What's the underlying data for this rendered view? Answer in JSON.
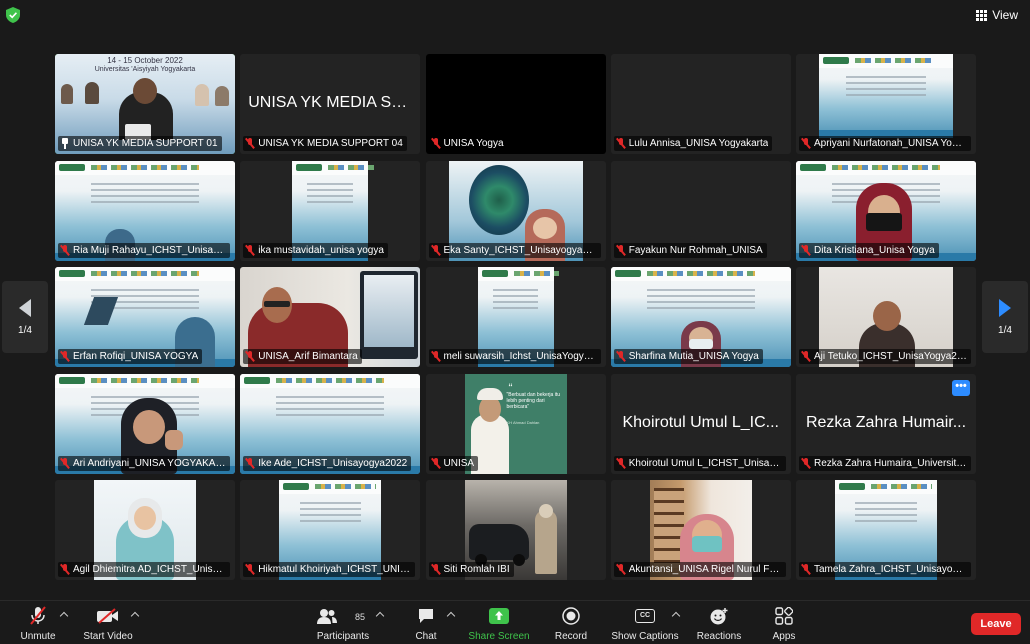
{
  "topbar": {
    "view_label": "View"
  },
  "pager": {
    "page_left": "1/4",
    "page_right": "1/4"
  },
  "tiles": [
    {
      "name": "UNISA YK MEDIA SUPPORT 01",
      "caption_line1": "14 - 15  October 2022",
      "caption_line2": "Universitas 'Aisyiyah Yogyakarta"
    },
    {
      "name": "UNISA YK MEDIA SUPPORT 04",
      "big_text": "UNISA YK MEDIA SU..."
    },
    {
      "name": "UNISA Yogya"
    },
    {
      "name": "Lulu Annisa_UNISA Yogyakarta"
    },
    {
      "name": "Apriyani Nurfatonah_UNISA Yogy..."
    },
    {
      "name": "Ria Muji Rahayu_ICHST_Unisayo..."
    },
    {
      "name": "ika mustavidah_unisa yogya"
    },
    {
      "name": "Eka Santy_ICHST_Unisayogya2022"
    },
    {
      "name": "Fayakun Nur Rohmah_UNISA"
    },
    {
      "name": "Dita Kristiana_Unisa Yogya"
    },
    {
      "name": "Erfan Rofiqi_UNISA YOGYA"
    },
    {
      "name": "UNISA_Arif Bimantara"
    },
    {
      "name": "meli suwarsih_Ichst_UnisaYogya..."
    },
    {
      "name": "Sharfina Mutia_UNISA Yogya"
    },
    {
      "name": "Aji Tetuko_ICHST_UnisaYogya2022"
    },
    {
      "name": "Ari Andriyani_UNISA YOGYAKARTA"
    },
    {
      "name": "Ike Ade_ICHST_Unisayogya2022"
    },
    {
      "name": "UNISA",
      "quote": "\"Berbuat dan bekerja itu lebih penting dari berbicara\"",
      "quote_author": "KH Ahmad Dahlan"
    },
    {
      "name": "Khoirotul Umul L_ICHST_Unisayo...",
      "big_text": "Khoirotul Umul L_IC..."
    },
    {
      "name": "Rezka Zahra Humaira_Universita...",
      "big_text": "Rezka Zahra Humair..."
    },
    {
      "name": "Agil Dhiemitra AD_ICHST_Unisay..."
    },
    {
      "name": "Hikmatul Khoiriyah_ICHST_UNIS..."
    },
    {
      "name": "Siti Romlah IBI"
    },
    {
      "name": "Akuntansi_UNISA Rigel Nurul Fat..."
    },
    {
      "name": "Tamela Zahra_ICHST_Unisayogy..."
    }
  ],
  "toolbar": {
    "unmute": "Unmute",
    "start_video": "Start Video",
    "participants": "Participants",
    "participants_count": "85",
    "chat": "Chat",
    "share_screen": "Share Screen",
    "record": "Record",
    "show_captions": "Show Captions",
    "captions_icon_text": "CC",
    "reactions": "Reactions",
    "apps": "Apps",
    "leave": "Leave"
  },
  "colors": {
    "accent": "#2d8cff",
    "share_green": "#3fc34b",
    "leave_red": "#e02828",
    "muted_red": "#e02828"
  }
}
